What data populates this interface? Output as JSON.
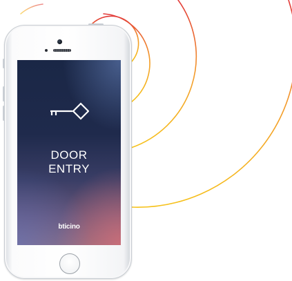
{
  "screen": {
    "title_line1": "DOOR",
    "title_line2": "ENTRY",
    "brand": "bticino"
  },
  "icons": {
    "app_icon": "key-icon",
    "signal_waves": "signal-waves-icon"
  },
  "colors": {
    "wave_yellow": "#f6c21a",
    "wave_orange": "#f08a2a",
    "wave_red": "#e23a3a",
    "screen_top": "#1a2746",
    "screen_bottom_accent": "#d26e78"
  }
}
